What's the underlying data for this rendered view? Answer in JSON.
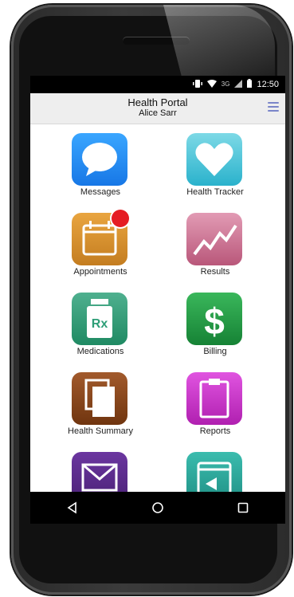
{
  "status_bar": {
    "time": "12:50",
    "network": "3G",
    "icons": [
      "vibrate-icon",
      "wifi-icon",
      "signal-icon",
      "battery-icon"
    ]
  },
  "header": {
    "title": "Health Portal",
    "subtitle": "Alice Sarr",
    "menu_icon": "hamburger-menu-icon"
  },
  "tiles": [
    {
      "label": "Messages",
      "icon": "chat-bubble-icon",
      "color": "#1f8cf3"
    },
    {
      "label": "Health Tracker",
      "icon": "heart-icon",
      "color": "#39c3d8"
    },
    {
      "label": "Appointments",
      "icon": "calendar-icon",
      "color": "#d98e2f",
      "badge": true
    },
    {
      "label": "Results",
      "icon": "trend-chart-icon",
      "color": "#c9708f"
    },
    {
      "label": "Medications",
      "icon": "rx-bottle-icon",
      "color": "#2e9e77"
    },
    {
      "label": "Billing",
      "icon": "dollar-icon",
      "color": "#27a04a"
    },
    {
      "label": "Health Summary",
      "icon": "documents-icon",
      "color": "#8f4a20"
    },
    {
      "label": "Reports",
      "icon": "clipboard-icon",
      "color": "#cf3ccf"
    },
    {
      "label": "",
      "icon": "envelope-icon",
      "color": "#5a2d8a"
    },
    {
      "label": "",
      "icon": "calendar-return-icon",
      "color": "#2aa79a"
    }
  ],
  "nav_bar": {
    "icons": [
      "back-icon",
      "home-icon",
      "recents-icon"
    ]
  },
  "colors": {
    "accent": "#7a85c9",
    "badge": "#e51c23"
  }
}
